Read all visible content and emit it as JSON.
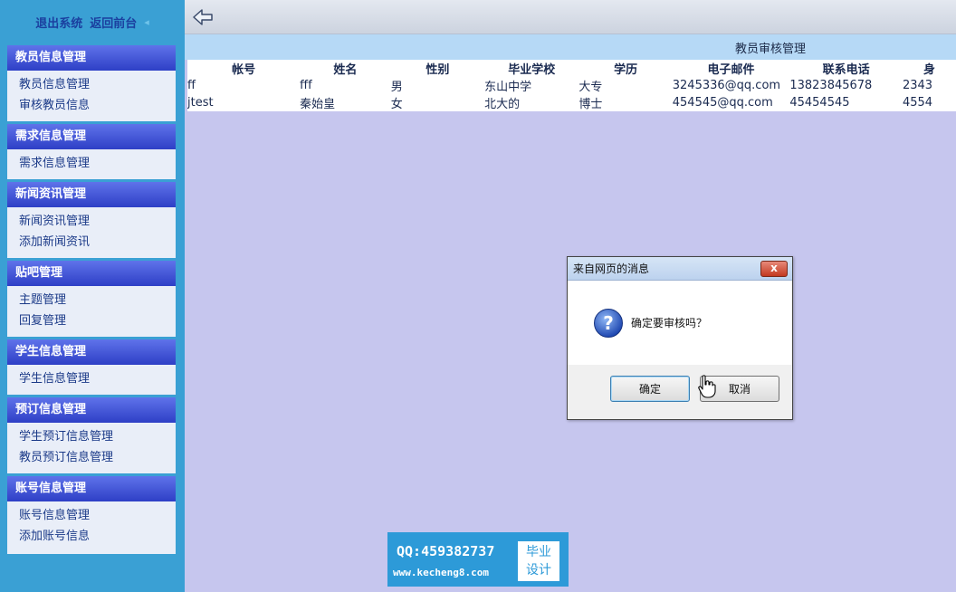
{
  "sidebar": {
    "top_links": [
      "退出系统",
      "返回前台"
    ],
    "groups": [
      {
        "title": "教员信息管理",
        "items": [
          "教员信息管理",
          "审核教员信息"
        ]
      },
      {
        "title": "需求信息管理",
        "items": [
          "需求信息管理"
        ]
      },
      {
        "title": "新闻资讯管理",
        "items": [
          "新闻资讯管理",
          "添加新闻资讯"
        ]
      },
      {
        "title": "贴吧管理",
        "items": [
          "主题管理",
          "回复管理"
        ]
      },
      {
        "title": "学生信息管理",
        "items": [
          "学生信息管理"
        ]
      },
      {
        "title": "预订信息管理",
        "items": [
          "学生预订信息管理",
          "教员预订信息管理"
        ]
      },
      {
        "title": "账号信息管理",
        "items": [
          "账号信息管理",
          "添加账号信息"
        ]
      }
    ]
  },
  "main": {
    "page_title": "教员审核管理",
    "table": {
      "headers": [
        "帐号",
        "姓名",
        "性别",
        "毕业学校",
        "学历",
        "电子邮件",
        "联系电话",
        "身"
      ],
      "rows": [
        [
          "ff",
          "fff",
          "男",
          "东山中学",
          "大专",
          "3245336@qq.com",
          "13823845678",
          "2343"
        ],
        [
          "jtest",
          "秦始皇",
          "女",
          "北大的",
          "博士",
          "454545@qq.com",
          "45454545",
          "4554"
        ]
      ]
    }
  },
  "dialog": {
    "title": "来自网页的消息",
    "message": "确定要审核吗？",
    "ok_label": "确定",
    "cancel_label": "取消",
    "close_label": "x",
    "icon": "question-icon"
  },
  "watermark": {
    "qq": "QQ:459382737",
    "url": "www.kecheng8.com",
    "badge_line1": "毕业",
    "badge_line2": "设计"
  },
  "colors": {
    "sidebar_bg": "#3aa0d4",
    "group_header": "#3a4ccc",
    "content_bg": "#c6c6ee",
    "title_bar": "#b6d9f6"
  }
}
